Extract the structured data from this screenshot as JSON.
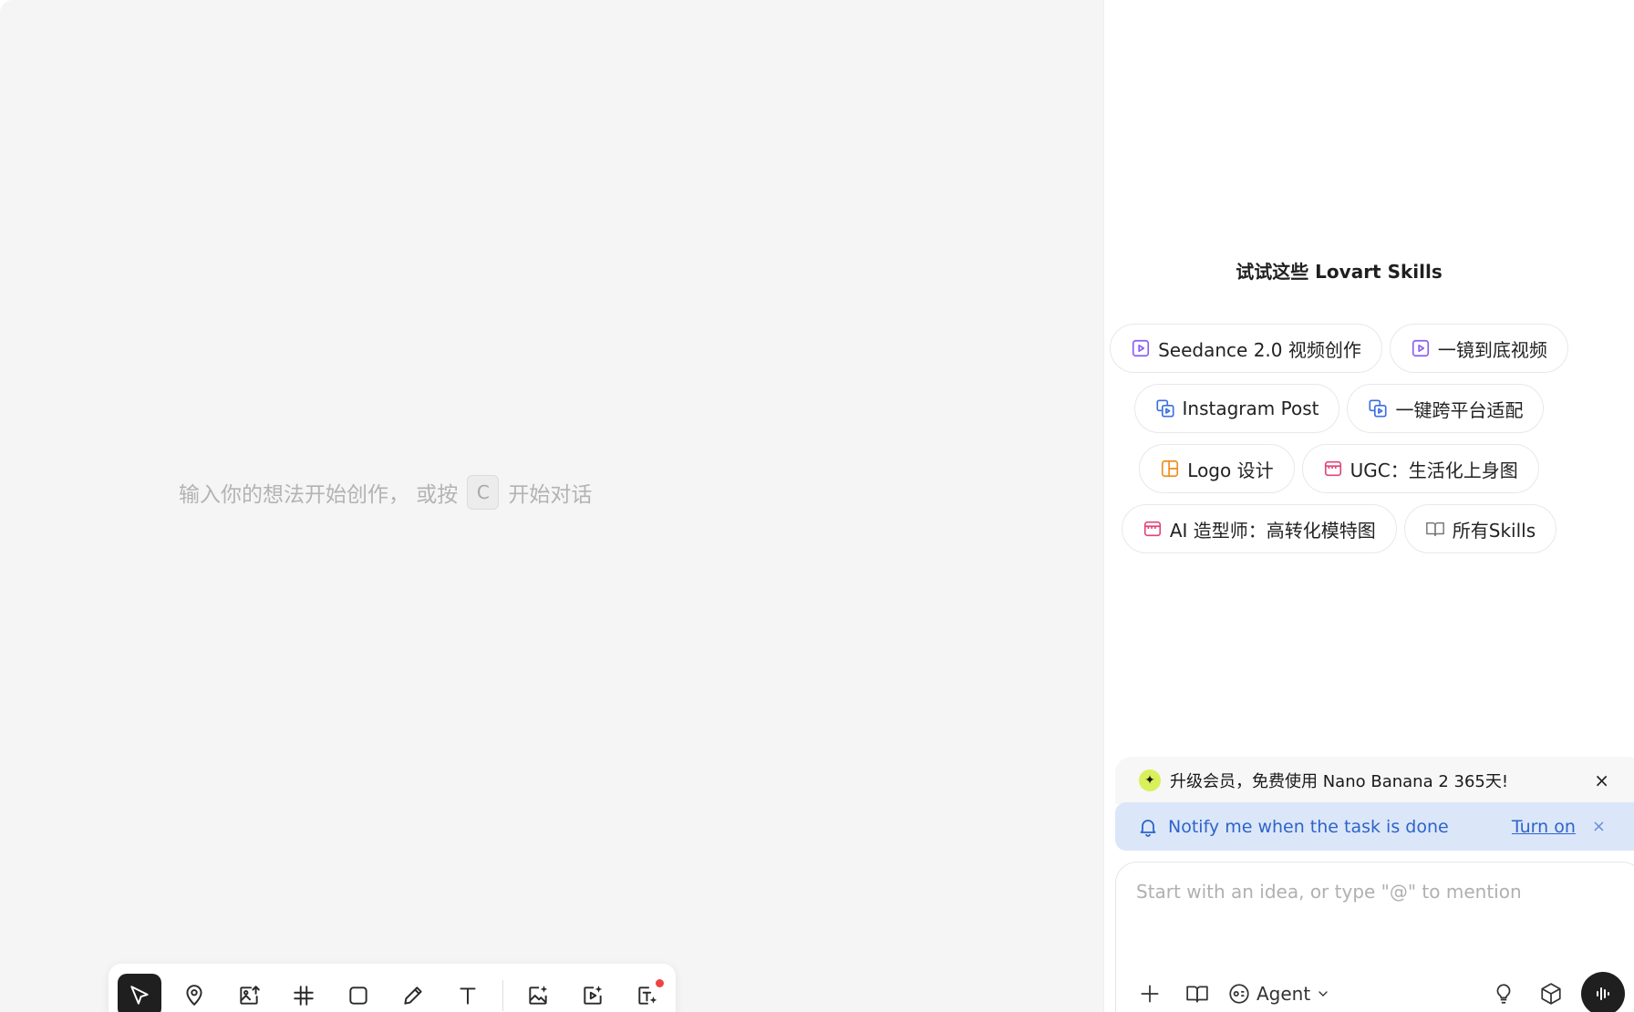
{
  "canvas": {
    "hint_before": "输入你的想法开始创作，  或按",
    "hint_key": "C",
    "hint_after": "开始对话"
  },
  "toolbar": {
    "tools": [
      {
        "name": "select",
        "icon": "cursor-arrow-icon",
        "active": true
      },
      {
        "name": "mark",
        "icon": "location-pin-icon"
      },
      {
        "name": "upload-image",
        "icon": "image-upload-icon"
      },
      {
        "name": "frame",
        "icon": "hash-frame-icon"
      },
      {
        "name": "rectangle",
        "icon": "square-icon"
      },
      {
        "name": "pen",
        "icon": "pencil-icon"
      },
      {
        "name": "text",
        "icon": "text-icon"
      },
      {
        "name": "ai-image",
        "icon": "ai-image-icon"
      },
      {
        "name": "ai-video",
        "icon": "ai-video-icon"
      },
      {
        "name": "ai-text",
        "icon": "ai-text-icon",
        "badge": true
      }
    ]
  },
  "skills": {
    "title": "试试这些 Lovart Skills",
    "rows": [
      [
        {
          "label": "Seedance 2.0 视频创作",
          "icon": "video-play-icon",
          "color": "#8b5cf6"
        },
        {
          "label": "一镜到底视频",
          "icon": "video-play-icon",
          "color": "#8b5cf6"
        }
      ],
      [
        {
          "label": "Instagram Post",
          "icon": "multi-media-icon",
          "color": "#3b6fe0"
        },
        {
          "label": "一键跨平台适配",
          "icon": "multi-media-icon",
          "color": "#3b6fe0"
        }
      ],
      [
        {
          "label": "Logo 设计",
          "icon": "layout-grid-icon",
          "color": "#f08c1a"
        },
        {
          "label": "UGC：生活化上身图",
          "icon": "storefront-icon",
          "color": "#e0457b"
        }
      ],
      [
        {
          "label": "AI 造型师：高转化模特图",
          "icon": "storefront-icon",
          "color": "#e0457b"
        },
        {
          "label": "所有Skills",
          "icon": "open-book-icon",
          "color": "#666666"
        }
      ]
    ]
  },
  "promo": {
    "icon": "sparkle-icon",
    "text": "升级会员，免费使用 Nano Banana 2 365天!",
    "close": "×"
  },
  "notify": {
    "icon": "bell-icon",
    "text": "Notify me when the task is done",
    "action": "Turn on",
    "close": "×"
  },
  "composer": {
    "placeholder": "Start with an idea, or type \"@\" to mention",
    "agent_label": "Agent",
    "buttons": [
      "plus-icon",
      "book-icon",
      "agent-icon",
      "lightbulb-icon",
      "cube-icon",
      "microphone-wave-icon"
    ]
  }
}
